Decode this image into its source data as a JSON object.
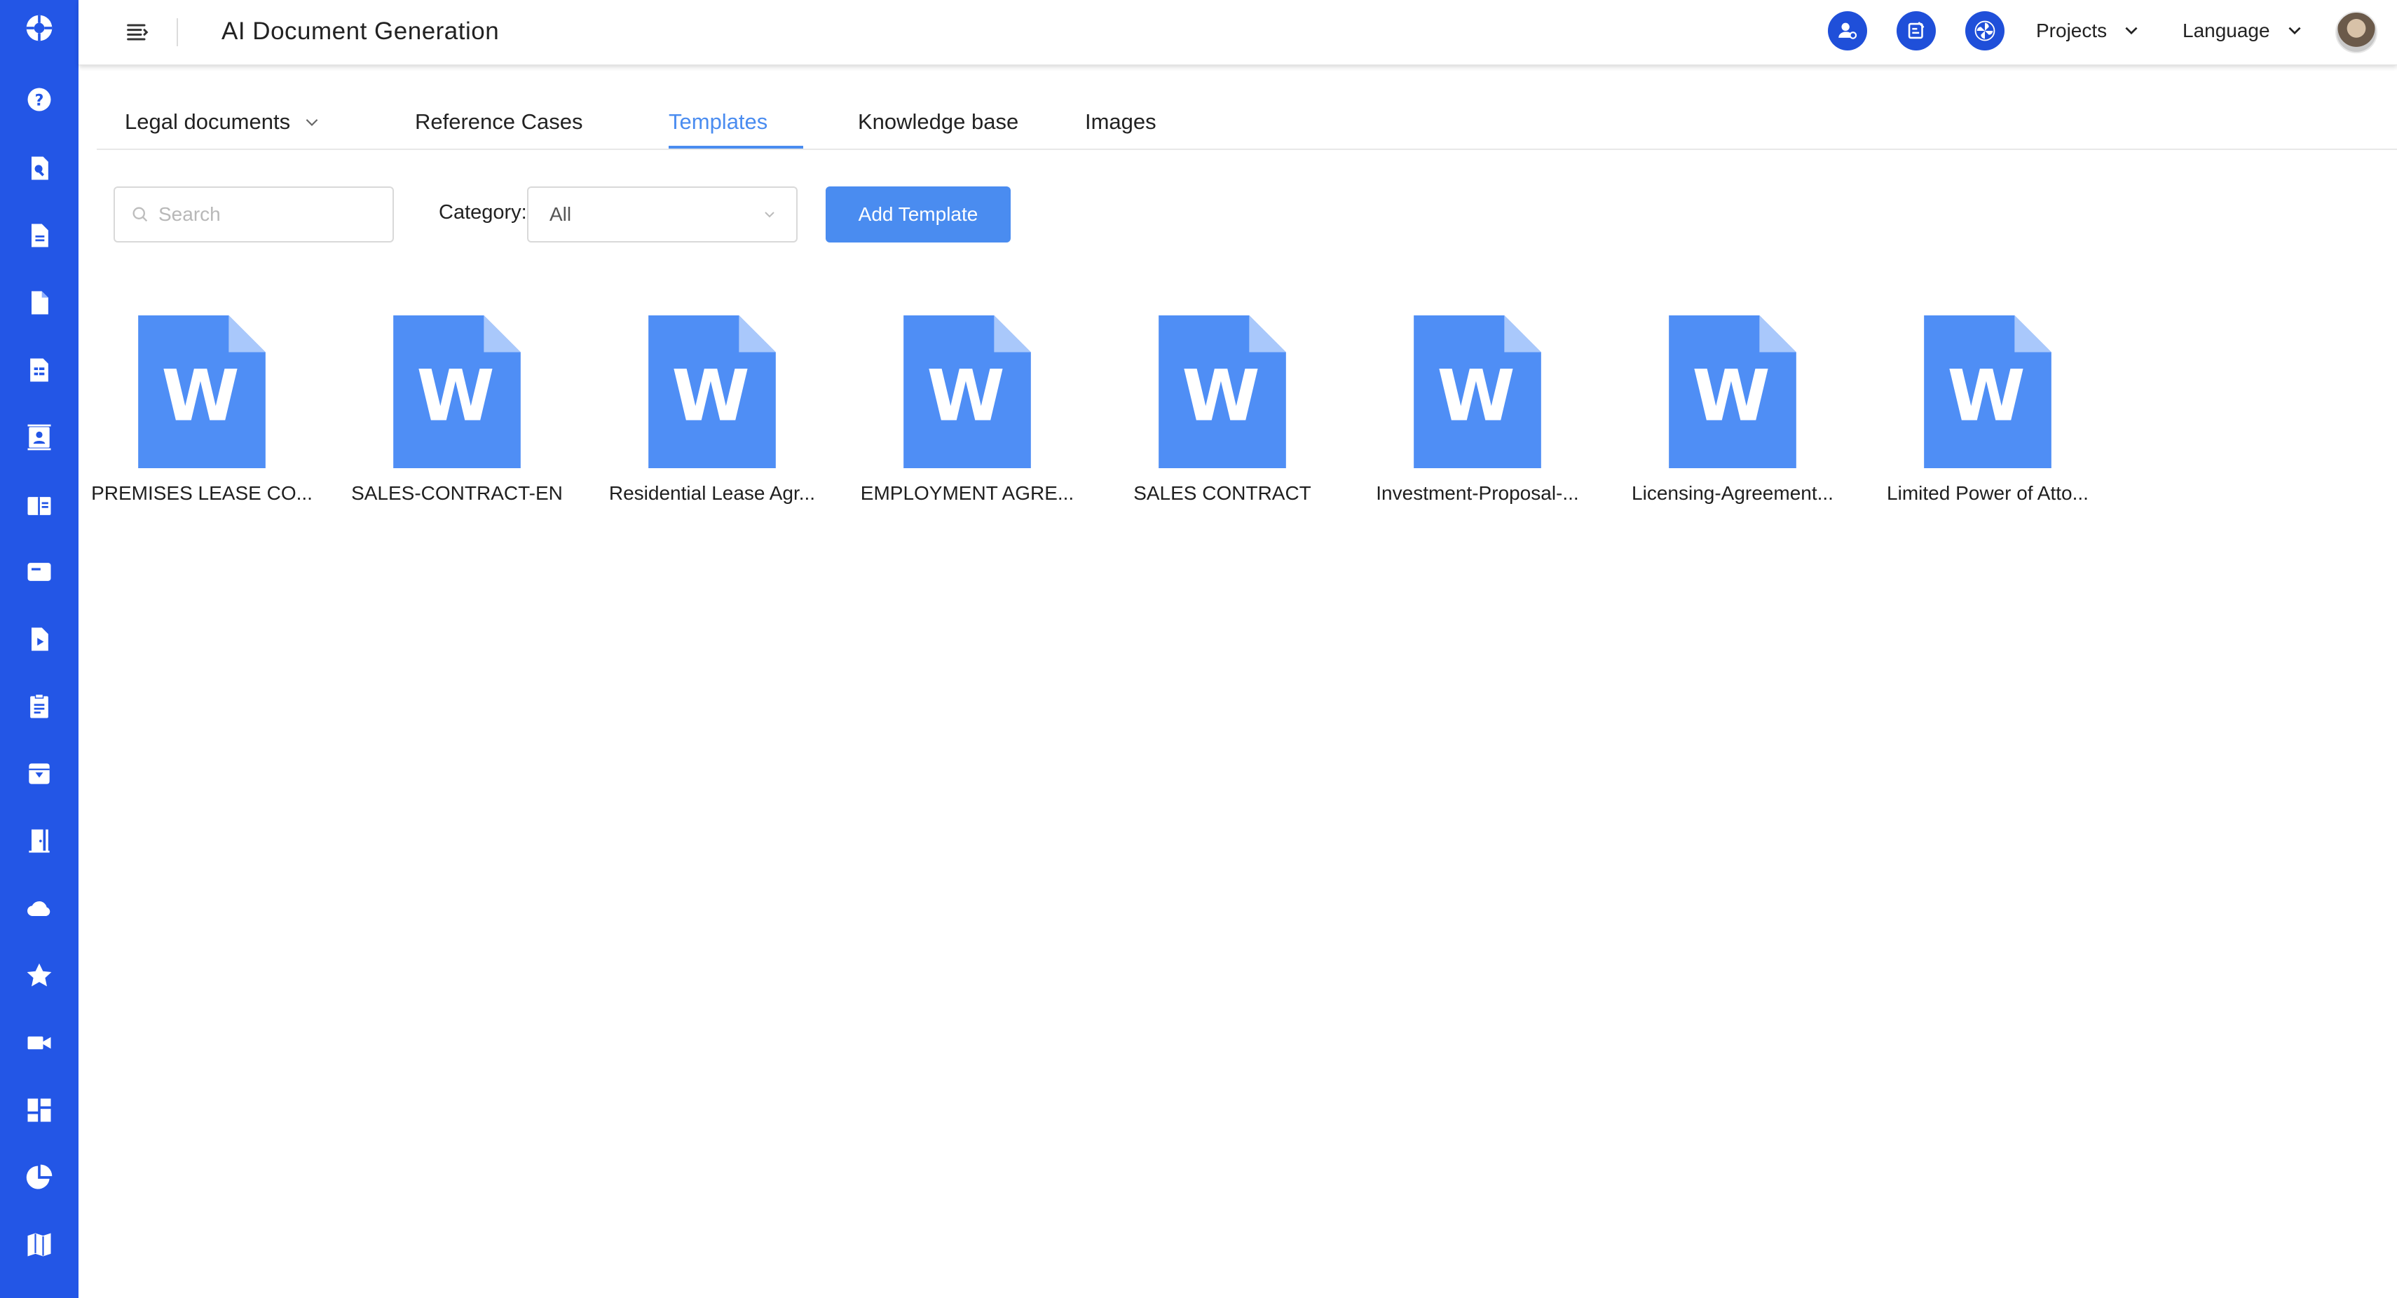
{
  "header": {
    "title": "AI Document Generation",
    "projects_label": "Projects",
    "language_label": "Language"
  },
  "sidebar": {
    "items": [
      {
        "icon": "help-icon"
      },
      {
        "icon": "doc-search-icon"
      },
      {
        "icon": "document-icon"
      },
      {
        "icon": "file-icon"
      },
      {
        "icon": "spreadsheet-icon"
      },
      {
        "icon": "contact-card-icon"
      },
      {
        "icon": "book-icon"
      },
      {
        "icon": "card-icon"
      },
      {
        "icon": "video-file-icon"
      },
      {
        "icon": "clipboard-icon"
      },
      {
        "icon": "archive-icon"
      },
      {
        "icon": "door-icon"
      },
      {
        "icon": "cloud-icon"
      },
      {
        "icon": "star-icon"
      },
      {
        "icon": "video-camera-icon"
      },
      {
        "icon": "dashboard-icon"
      },
      {
        "icon": "pie-chart-icon"
      },
      {
        "icon": "map-icon"
      }
    ]
  },
  "tabs": [
    {
      "label": "Legal documents"
    },
    {
      "label": "Reference Cases"
    },
    {
      "label": "Templates"
    },
    {
      "label": "Knowledge base"
    },
    {
      "label": "Images"
    }
  ],
  "active_tab": "Templates",
  "toolbar": {
    "search_placeholder": "Search",
    "category_label": "Category:",
    "category_value": "All",
    "add_button": "Add Template"
  },
  "templates": [
    {
      "name": "PREMISES LEASE CO..."
    },
    {
      "name": "SALES-CONTRACT-EN"
    },
    {
      "name": "Residential Lease Agr..."
    },
    {
      "name": "EMPLOYMENT AGRE..."
    },
    {
      "name": "SALES CONTRACT"
    },
    {
      "name": "Investment-Proposal-..."
    },
    {
      "name": "Licensing-Agreement..."
    },
    {
      "name": "Limited Power of Atto..."
    }
  ],
  "colors": {
    "sidebar": "#2356e6",
    "accent": "#4a8cf0",
    "doc_icon": "#4f8ef5"
  }
}
